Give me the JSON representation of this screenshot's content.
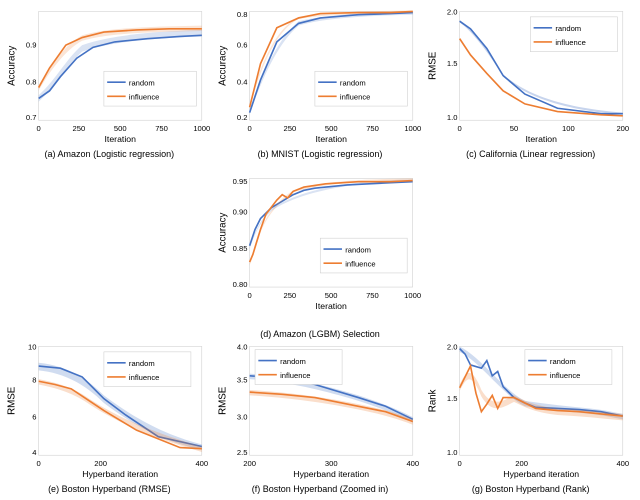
{
  "charts": {
    "a": {
      "title": "(a) Amazon (Logistic regression)",
      "ylabel": "Accuracy",
      "xlabel": "Iteration",
      "xmax": 1000,
      "ymin": 0.7,
      "ymax": 0.9
    },
    "b": {
      "title": "(b) MNIST (Logistic regression)",
      "ylabel": "Accuracy",
      "xlabel": "Iteration",
      "xmax": 1000,
      "ymin": 0.2,
      "ymax": 0.8
    },
    "c": {
      "title": "(c) California (Linear regression)",
      "ylabel": "RMSE",
      "xlabel": "Iteration",
      "xmax": 200,
      "ymin": 1.0,
      "ymax": 2.0
    },
    "d": {
      "title": "(d) Amazon (LGBM) Selection",
      "ylabel": "Accuracy",
      "xlabel": "Iteration",
      "xmax": 1000,
      "ymin": 0.8,
      "ymax": 0.95
    },
    "e": {
      "title": "(e) Boston Hyperband (RMSE)",
      "ylabel": "RMSE",
      "xlabel": "Hyperband iteration",
      "xmax": 400,
      "ymin": 4.0,
      "ymax": 10.0
    },
    "f": {
      "title": "(f) Boston Hyperband (Zoomed in)",
      "ylabel": "RMSE",
      "xlabel": "Hyperband iteration",
      "xmax": 400,
      "ymin": 2.5,
      "ymax": 4.0
    },
    "g": {
      "title": "(g) Boston Hyperband (Rank)",
      "ylabel": "Rank",
      "xlabel": "Hyperband iteration",
      "xmax": 400,
      "ymin": 1.0,
      "ymax": 2.0
    }
  },
  "legend": {
    "random_label": "random",
    "influence_label": "influence"
  },
  "colors": {
    "blue": "#4472c4",
    "orange": "#ed7d31",
    "blue_fill": "rgba(68,114,196,0.25)",
    "orange_fill": "rgba(237,125,49,0.25)"
  }
}
